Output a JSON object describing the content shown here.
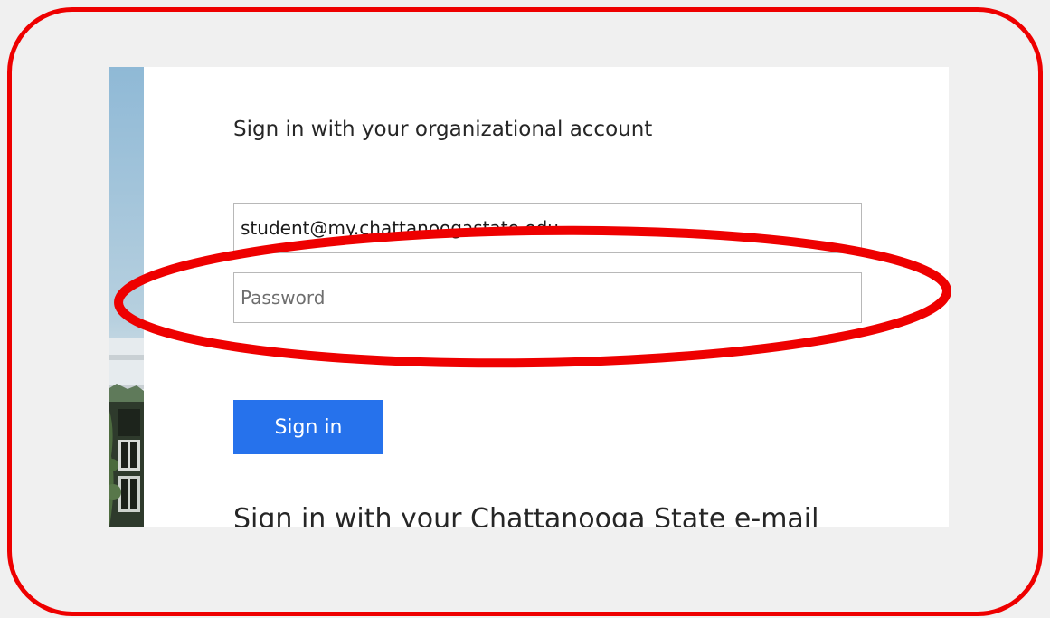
{
  "login": {
    "org_heading": "Sign in with your organizational account",
    "email_value": "student@my.chattanoogastate.edu",
    "password_placeholder": "Password",
    "signin_label": "Sign in",
    "alt_heading": "Sign in with your Chattanooga State e-mail"
  },
  "colors": {
    "frame_border": "#ee0000",
    "highlight_ellipse": "#ee0000",
    "signin_button": "#2672ec",
    "background": "#f0f0f0"
  }
}
